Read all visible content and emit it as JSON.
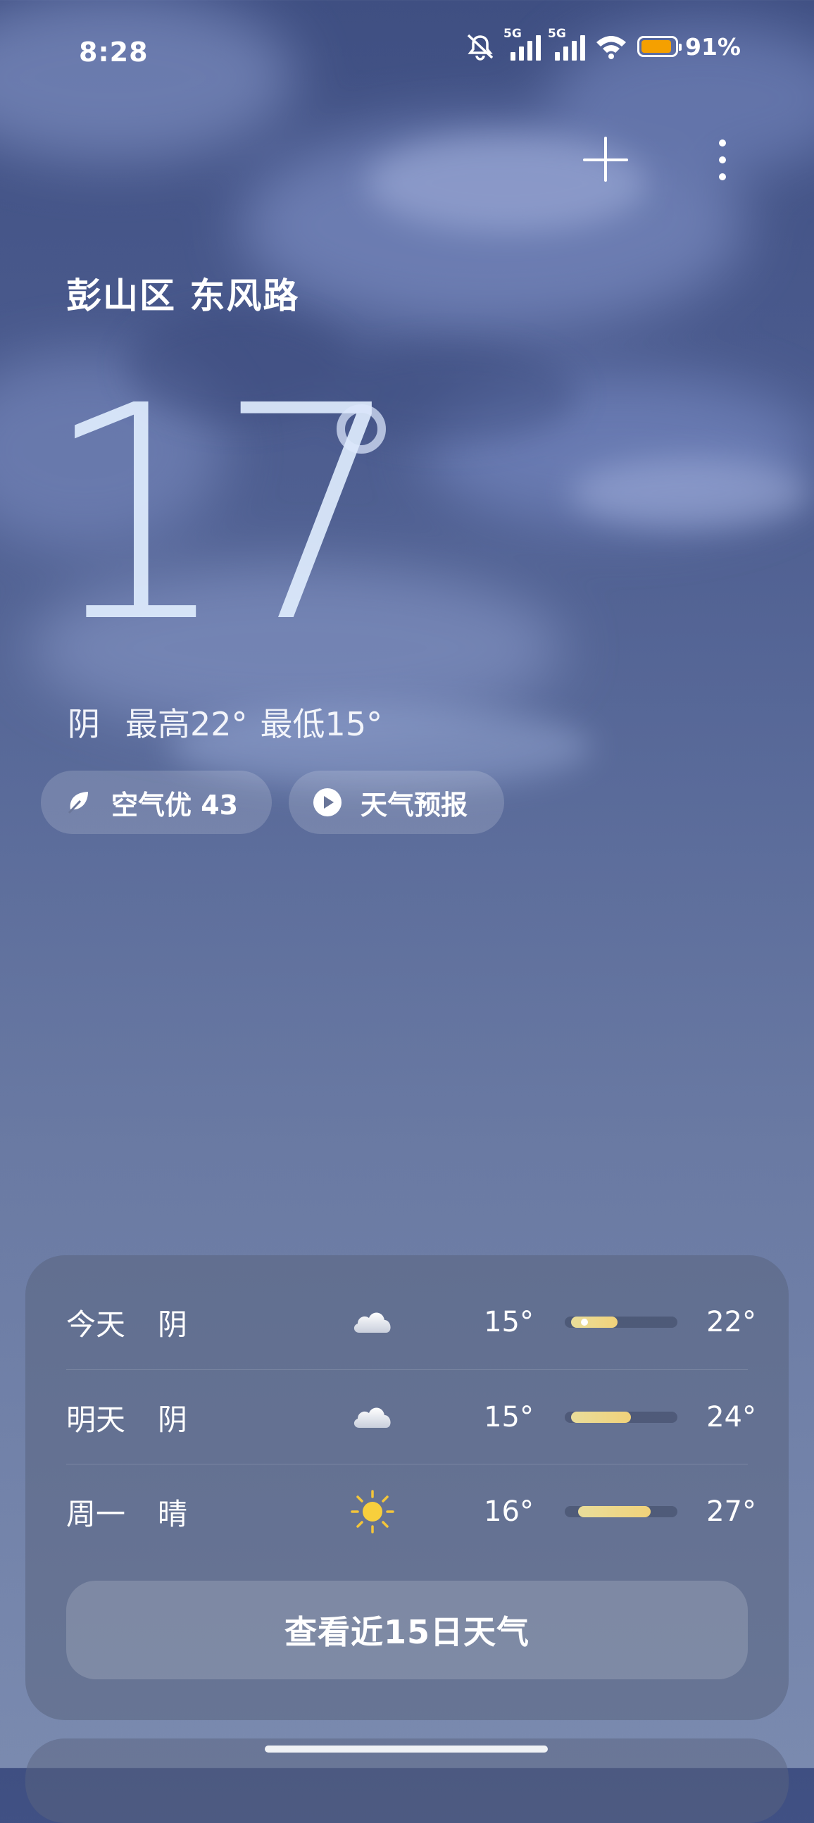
{
  "status_bar": {
    "time": "8:28",
    "network_1": "5G",
    "network_2": "5G",
    "battery_percent": "91%",
    "battery_level": 0.91,
    "battery_color": "#f5a000",
    "icons": [
      "mute-icon",
      "signal-icon",
      "signal-icon",
      "wifi-icon",
      "battery-icon"
    ]
  },
  "header": {
    "add_icon": "plus-icon",
    "menu_icon": "more-vertical-icon"
  },
  "location": "彭山区 东风路",
  "current": {
    "temperature": "17",
    "condition": "阴",
    "high": "最高22°",
    "low": "最低15°"
  },
  "pills": {
    "aqi_label": "空气优 43",
    "aqi_icon": "leaf-icon",
    "forecast_label": "天气预报",
    "forecast_icon": "play-icon"
  },
  "forecast": {
    "days": [
      {
        "day": "今天",
        "condition": "阴",
        "icon": "cloud-icon",
        "low": "15°",
        "high": "22°",
        "low_value": 15,
        "high_value": 22,
        "current_marker": true
      },
      {
        "day": "明天",
        "condition": "阴",
        "icon": "cloud-icon",
        "low": "15°",
        "high": "24°",
        "low_value": 15,
        "high_value": 24
      },
      {
        "day": "周一",
        "condition": "晴",
        "icon": "sun-icon",
        "low": "16°",
        "high": "27°",
        "low_value": 16,
        "high_value": 27
      }
    ],
    "more_button": "查看近15日天气"
  }
}
